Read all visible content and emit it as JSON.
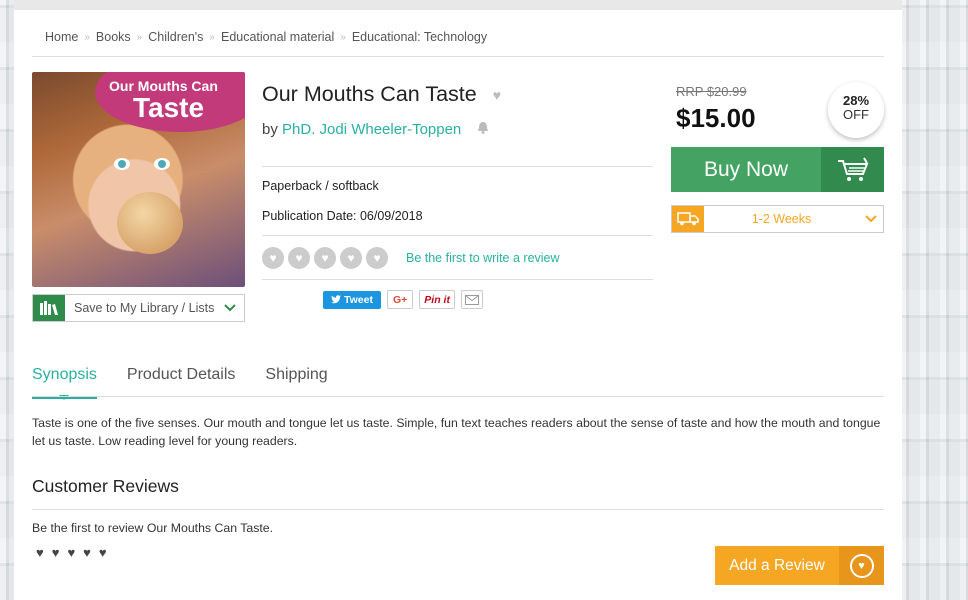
{
  "breadcrumb": [
    "Home",
    "Books",
    "Children's",
    "Educational material",
    "Educational: Technology"
  ],
  "breadcrumb_separator": "»",
  "cover": {
    "title_line1": "Our Mouths Can",
    "title_line2": "Taste"
  },
  "save_library": {
    "label": "Save to My Library / Lists",
    "icon": "library-icon"
  },
  "product": {
    "title": "Our Mouths Can Taste",
    "by_prefix": "by",
    "author": "PhD. Jodi Wheeler-Toppen",
    "format": "Paperback / softback",
    "publication_date": "Publication Date: 06/09/2018",
    "review_prompt": "Be the first to write a review",
    "rating_max": 5
  },
  "share": {
    "tweet": "Tweet",
    "gplus": "G+",
    "pinit": "Pin it"
  },
  "pricing": {
    "rrp": "RRP $20.99",
    "price": "$15.00",
    "discount_percent": "28%",
    "discount_label": "OFF",
    "buy_label": "Buy Now",
    "shipping": "1-2 Weeks"
  },
  "tabs": [
    "Synopsis",
    "Product Details",
    "Shipping"
  ],
  "active_tab": "Synopsis",
  "synopsis": "Taste is one of the five senses. Our mouth and tongue let us taste. Simple, fun text teaches readers about the sense of taste and how the mouth and tongue let us taste. Low reading level for young readers.",
  "reviews": {
    "title": "Customer Reviews",
    "empty_text": "Be the first to review Our Mouths Can Taste.",
    "add_label": "Add a Review"
  },
  "colors": {
    "accent_teal": "#2ab0a0",
    "buy_green": "#44a363",
    "orange": "#f5a623"
  }
}
